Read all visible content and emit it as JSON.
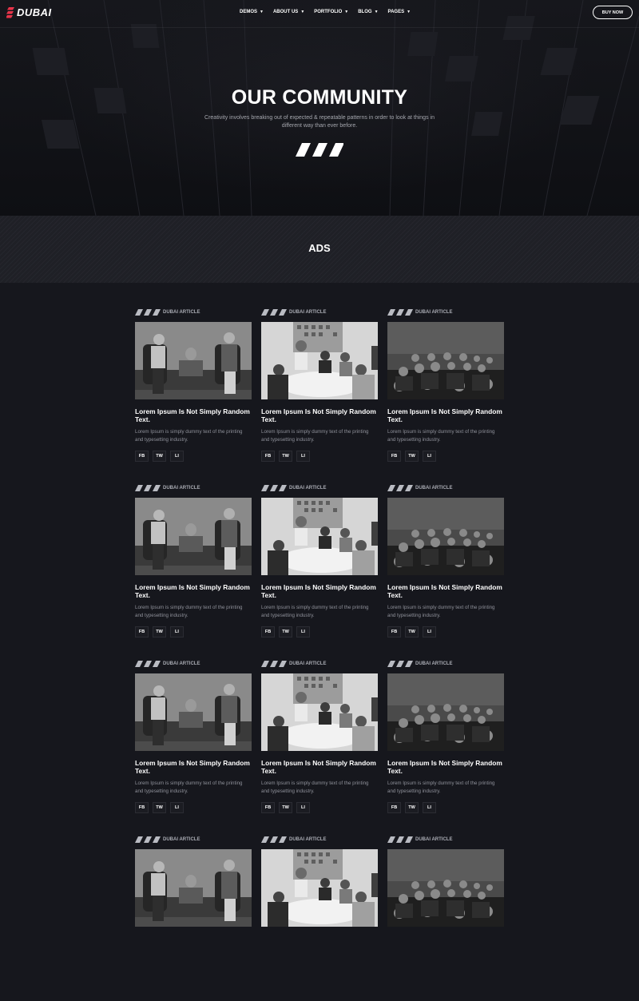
{
  "nav": {
    "logo": "DUBAI",
    "menu": [
      {
        "label": "DEMOS"
      },
      {
        "label": "ABOUT US"
      },
      {
        "label": "PORTFOLIO"
      },
      {
        "label": "BLOG"
      },
      {
        "label": "PAGES"
      }
    ],
    "buy_label": "BUY NOW"
  },
  "hero": {
    "title": "OUR COMMUNITY",
    "subtitle": "Creativity involves breaking out of expected & repeatable patterns in order to look at things in different way than ever before."
  },
  "section": {
    "title": "ADS"
  },
  "articles": [
    {
      "tag": "DUBAI ARTICLE",
      "title": "Lorem Ipsum Is Not Simply Random Text.",
      "desc": "Lorem Ipsum is simply dummy text of the printing and typesetting industry.",
      "socials": [
        "FB",
        "TW",
        "LI"
      ],
      "image": "office-meeting-photo"
    },
    {
      "tag": "DUBAI ARTICLE",
      "title": "Lorem Ipsum Is Not Simply Random Text.",
      "desc": "Lorem Ipsum is simply dummy text of the printing and typesetting industry.",
      "socials": [
        "FB",
        "TW",
        "LI"
      ],
      "image": "team-table-photo"
    },
    {
      "tag": "DUBAI ARTICLE",
      "title": "Lorem Ipsum Is Not Simply Random Text.",
      "desc": "Lorem Ipsum is simply dummy text of the printing and typesetting industry.",
      "socials": [
        "FB",
        "TW",
        "LI"
      ],
      "image": "audience-photo"
    },
    {
      "tag": "DUBAI ARTICLE",
      "title": "Lorem Ipsum Is Not Simply Random Text.",
      "desc": "Lorem Ipsum is simply dummy text of the printing and typesetting industry.",
      "socials": [
        "FB",
        "TW",
        "LI"
      ],
      "image": "office-meeting-photo"
    },
    {
      "tag": "DUBAI ARTICLE",
      "title": "Lorem Ipsum Is Not Simply Random Text.",
      "desc": "Lorem Ipsum is simply dummy text of the printing and typesetting industry.",
      "socials": [
        "FB",
        "TW",
        "LI"
      ],
      "image": "team-table-photo"
    },
    {
      "tag": "DUBAI ARTICLE",
      "title": "Lorem Ipsum Is Not Simply Random Text.",
      "desc": "Lorem Ipsum is simply dummy text of the printing and typesetting industry.",
      "socials": [
        "FB",
        "TW",
        "LI"
      ],
      "image": "audience-photo"
    },
    {
      "tag": "DUBAI ARTICLE",
      "title": "Lorem Ipsum Is Not Simply Random Text.",
      "desc": "Lorem Ipsum is simply dummy text of the printing and typesetting industry.",
      "socials": [
        "FB",
        "TW",
        "LI"
      ],
      "image": "office-meeting-photo"
    },
    {
      "tag": "DUBAI ARTICLE",
      "title": "Lorem Ipsum Is Not Simply Random Text.",
      "desc": "Lorem Ipsum is simply dummy text of the printing and typesetting industry.",
      "socials": [
        "FB",
        "TW",
        "LI"
      ],
      "image": "team-table-photo"
    },
    {
      "tag": "DUBAI ARTICLE",
      "title": "Lorem Ipsum Is Not Simply Random Text.",
      "desc": "Lorem Ipsum is simply dummy text of the printing and typesetting industry.",
      "socials": [
        "FB",
        "TW",
        "LI"
      ],
      "image": "audience-photo"
    },
    {
      "tag": "DUBAI ARTICLE",
      "title": "",
      "desc": "",
      "socials": [],
      "image": "office-meeting-photo"
    },
    {
      "tag": "DUBAI ARTICLE",
      "title": "",
      "desc": "",
      "socials": [],
      "image": "team-table-photo"
    },
    {
      "tag": "DUBAI ARTICLE",
      "title": "",
      "desc": "",
      "socials": [],
      "image": "audience-photo"
    }
  ],
  "colors": {
    "brand": "#e8344a",
    "background": "#16171d",
    "muted_text": "#8f919a"
  }
}
